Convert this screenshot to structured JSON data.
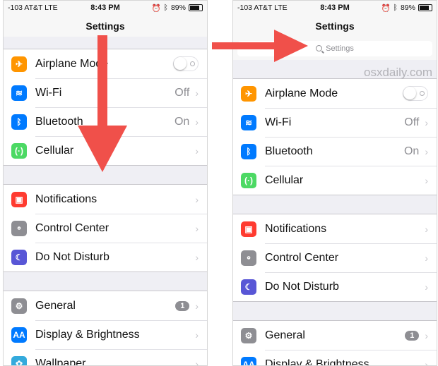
{
  "status": {
    "carrier": "-103 AT&T",
    "network": "LTE",
    "time": "8:43 PM",
    "battery": "89%"
  },
  "nav_title": "Settings",
  "search": {
    "placeholder": "Settings"
  },
  "watermark": "osxdaily.com",
  "settings": {
    "airplane": {
      "label": "Airplane Mode",
      "icon": "airplane-icon",
      "color": "#ff9500"
    },
    "wifi": {
      "label": "Wi-Fi",
      "value": "Off",
      "icon": "wifi-icon",
      "color": "#007aff"
    },
    "bluetooth": {
      "label": "Bluetooth",
      "value": "On",
      "icon": "bluetooth-icon",
      "color": "#007aff"
    },
    "cellular": {
      "label": "Cellular",
      "icon": "cellular-icon",
      "color": "#4cd964"
    },
    "notifications": {
      "label": "Notifications",
      "icon": "notifications-icon",
      "color": "#ff3b30"
    },
    "control_center": {
      "label": "Control Center",
      "icon": "control-center-icon",
      "color": "#8e8e93"
    },
    "dnd": {
      "label": "Do Not Disturb",
      "icon": "moon-icon",
      "color": "#5856d6"
    },
    "general": {
      "label": "General",
      "badge": "1",
      "icon": "gear-icon",
      "color": "#8e8e93"
    },
    "display": {
      "label": "Display & Brightness",
      "icon": "display-icon",
      "color": "#007aff"
    },
    "wallpaper": {
      "label": "Wallpaper",
      "icon": "wallpaper-icon",
      "color": "#34aadc"
    }
  },
  "arrow_color": "#f0504a"
}
